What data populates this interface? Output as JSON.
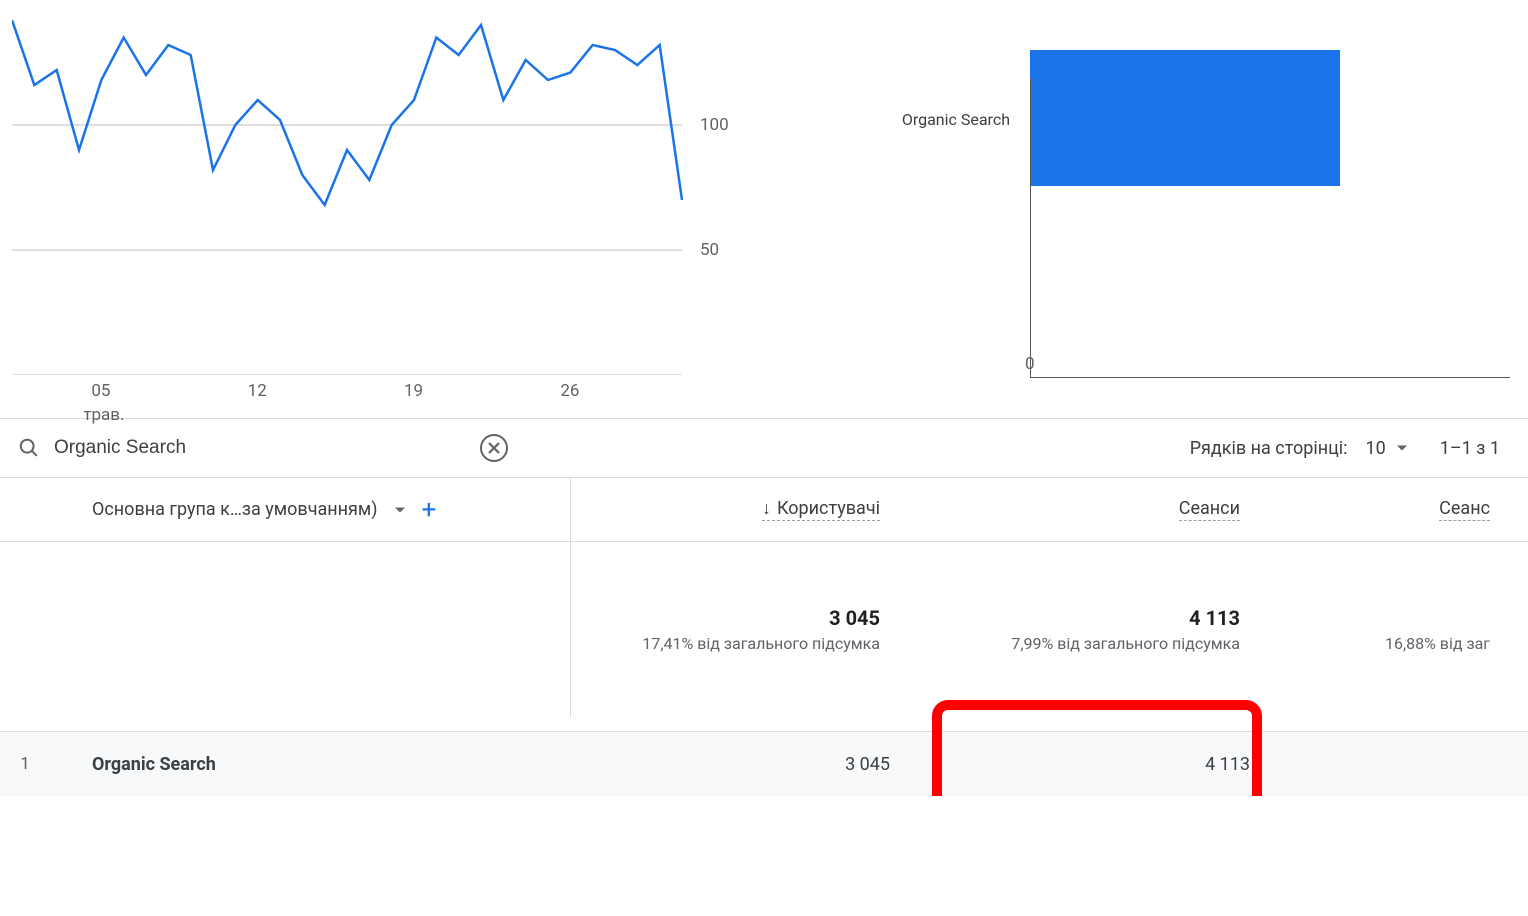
{
  "chart_data": [
    {
      "type": "line",
      "x": [
        1,
        2,
        3,
        4,
        5,
        6,
        7,
        8,
        9,
        10,
        11,
        12,
        13,
        14,
        15,
        16,
        17,
        18,
        19,
        20,
        21,
        22,
        23,
        24,
        25,
        26,
        27,
        28,
        29,
        30,
        31
      ],
      "values": [
        142,
        116,
        122,
        90,
        118,
        135,
        120,
        132,
        128,
        82,
        100,
        110,
        102,
        80,
        68,
        90,
        78,
        100,
        110,
        135,
        128,
        140,
        110,
        126,
        118,
        121,
        132,
        130,
        124,
        132,
        70
      ],
      "x_ticks": [
        {
          "pos": 5,
          "label": "05"
        },
        {
          "pos": 12,
          "label": "12"
        },
        {
          "pos": 19,
          "label": "19"
        },
        {
          "pos": 26,
          "label": "26"
        }
      ],
      "x_sub_label": "трав.",
      "y_ticks": [
        0,
        50,
        100
      ],
      "ylim": [
        0,
        150
      ]
    },
    {
      "type": "bar",
      "orientation": "horizontal",
      "categories": [
        "Organic Search"
      ],
      "values": [
        4113
      ],
      "x_zero_label": "0"
    }
  ],
  "filter": {
    "search_value": "Organic Search",
    "rows_per_page_label": "Рядків на сторінці:",
    "rows_per_page_value": "10",
    "pager_text": "1–1 з 1"
  },
  "table": {
    "dimension_label": "Основна група к…за умовчанням)",
    "columns": [
      {
        "label": "Користувачі",
        "sorted": true
      },
      {
        "label": "Сеанси",
        "sorted": false
      },
      {
        "label": "Сеанс",
        "sorted": false
      }
    ],
    "totals": {
      "c1_value": "3 045",
      "c1_sub": "17,41% від загального підсумка",
      "c2_value": "4 113",
      "c2_sub": "7,99% від загального підсумка",
      "c3_sub": "16,88% від заг"
    },
    "rows": [
      {
        "idx": "1",
        "name": "Organic Search",
        "c1": "3 045",
        "c2": "4 113"
      }
    ]
  },
  "colors": {
    "primary": "#1a73e8",
    "highlight": "#ff0000"
  }
}
